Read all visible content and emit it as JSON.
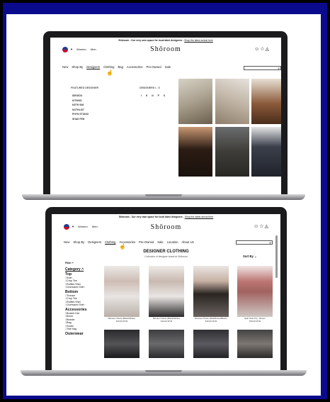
{
  "page1": {
    "announcement": "Shōroom - Our very own space for local label designers -",
    "announcement_link": "Shop the latest arrival here",
    "gender_women": "Women",
    "gender_men": "Men",
    "logo": "Shōroom",
    "nav": [
      "New",
      "Shop By",
      "Designers",
      "Clothing",
      "Bag",
      "Accessories",
      "Pre-Owned",
      "Sale"
    ],
    "featured_title": "FEATURED DESIGNER",
    "designers": [
      "IDEOIDO",
      "KITWOD",
      "KETH SIM",
      "NOTHLIST",
      "PHYN STUDIO",
      "SHAD FEN"
    ],
    "designers_az_title": "DESIGNERS I - S",
    "letters": "I K N P S"
  },
  "page2": {
    "announcement": "Shōroom - Our very own space for local label designers -",
    "announcement_link": "Shop the latest arrival here",
    "gender_women": "Women",
    "gender_men": "Men",
    "logo": "Shōroom",
    "nav": [
      "New",
      "Shop By",
      "Designers",
      "Clothing",
      "Accessories",
      "Pre-Owned",
      "Sale",
      "Location",
      "About Us"
    ],
    "page_title": "DESIGNER CLOTHING",
    "page_subtitle": "Collection of designer brand at Shōroom",
    "sort_label": "Sort By",
    "filter_label": "Filter +",
    "sidebar": {
      "category": "Category",
      "top": "Top",
      "top_items": [
        "Shirt",
        "Crop Tee",
        "Ruffles Shirt",
        "Oversized Shirt"
      ],
      "bottom": "Bottom",
      "bottom_items": [
        "Trouser",
        "Crop Tee",
        "Ruffles Shirt",
        "Oversized Shirt"
      ],
      "accessories": "Accessories",
      "accessories_items": [
        "Bucket Hat",
        "Beret",
        "Beanie",
        "Bag",
        "Socks",
        "Tote bag"
      ],
      "outerwear": "Outerwear"
    },
    "products": [
      {
        "name": "Bicolour Pants (Black/White)",
        "price": "340.00 MYR"
      },
      {
        "name": "Bicolour Pants (Black/White)",
        "price": "340.00 MYR"
      },
      {
        "name": "Bicolour Pants (Red/Brown/Black)",
        "price": "340.00 MYR"
      },
      {
        "name": "Split Tank Top - Brown",
        "price": "780.00 MYR"
      }
    ]
  }
}
